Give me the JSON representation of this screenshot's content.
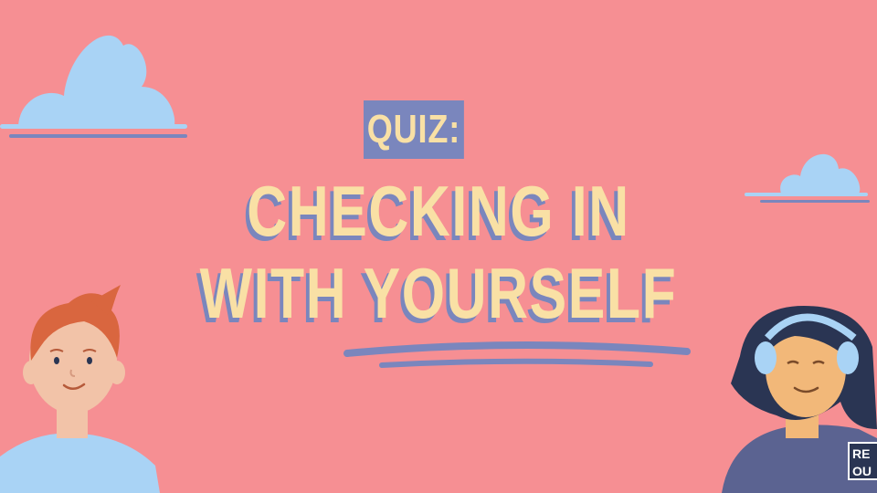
{
  "badge": {
    "label": "QUIZ:"
  },
  "title": {
    "line1": "CHECKING IN",
    "line2": "WITH YOURSELF"
  },
  "logo": {
    "line1": "RE",
    "line2": "OU"
  },
  "colors": {
    "background": "#f68f93",
    "text": "#f9e0a5",
    "accent": "#7a86bd",
    "cloud": "#a9d3f5"
  }
}
